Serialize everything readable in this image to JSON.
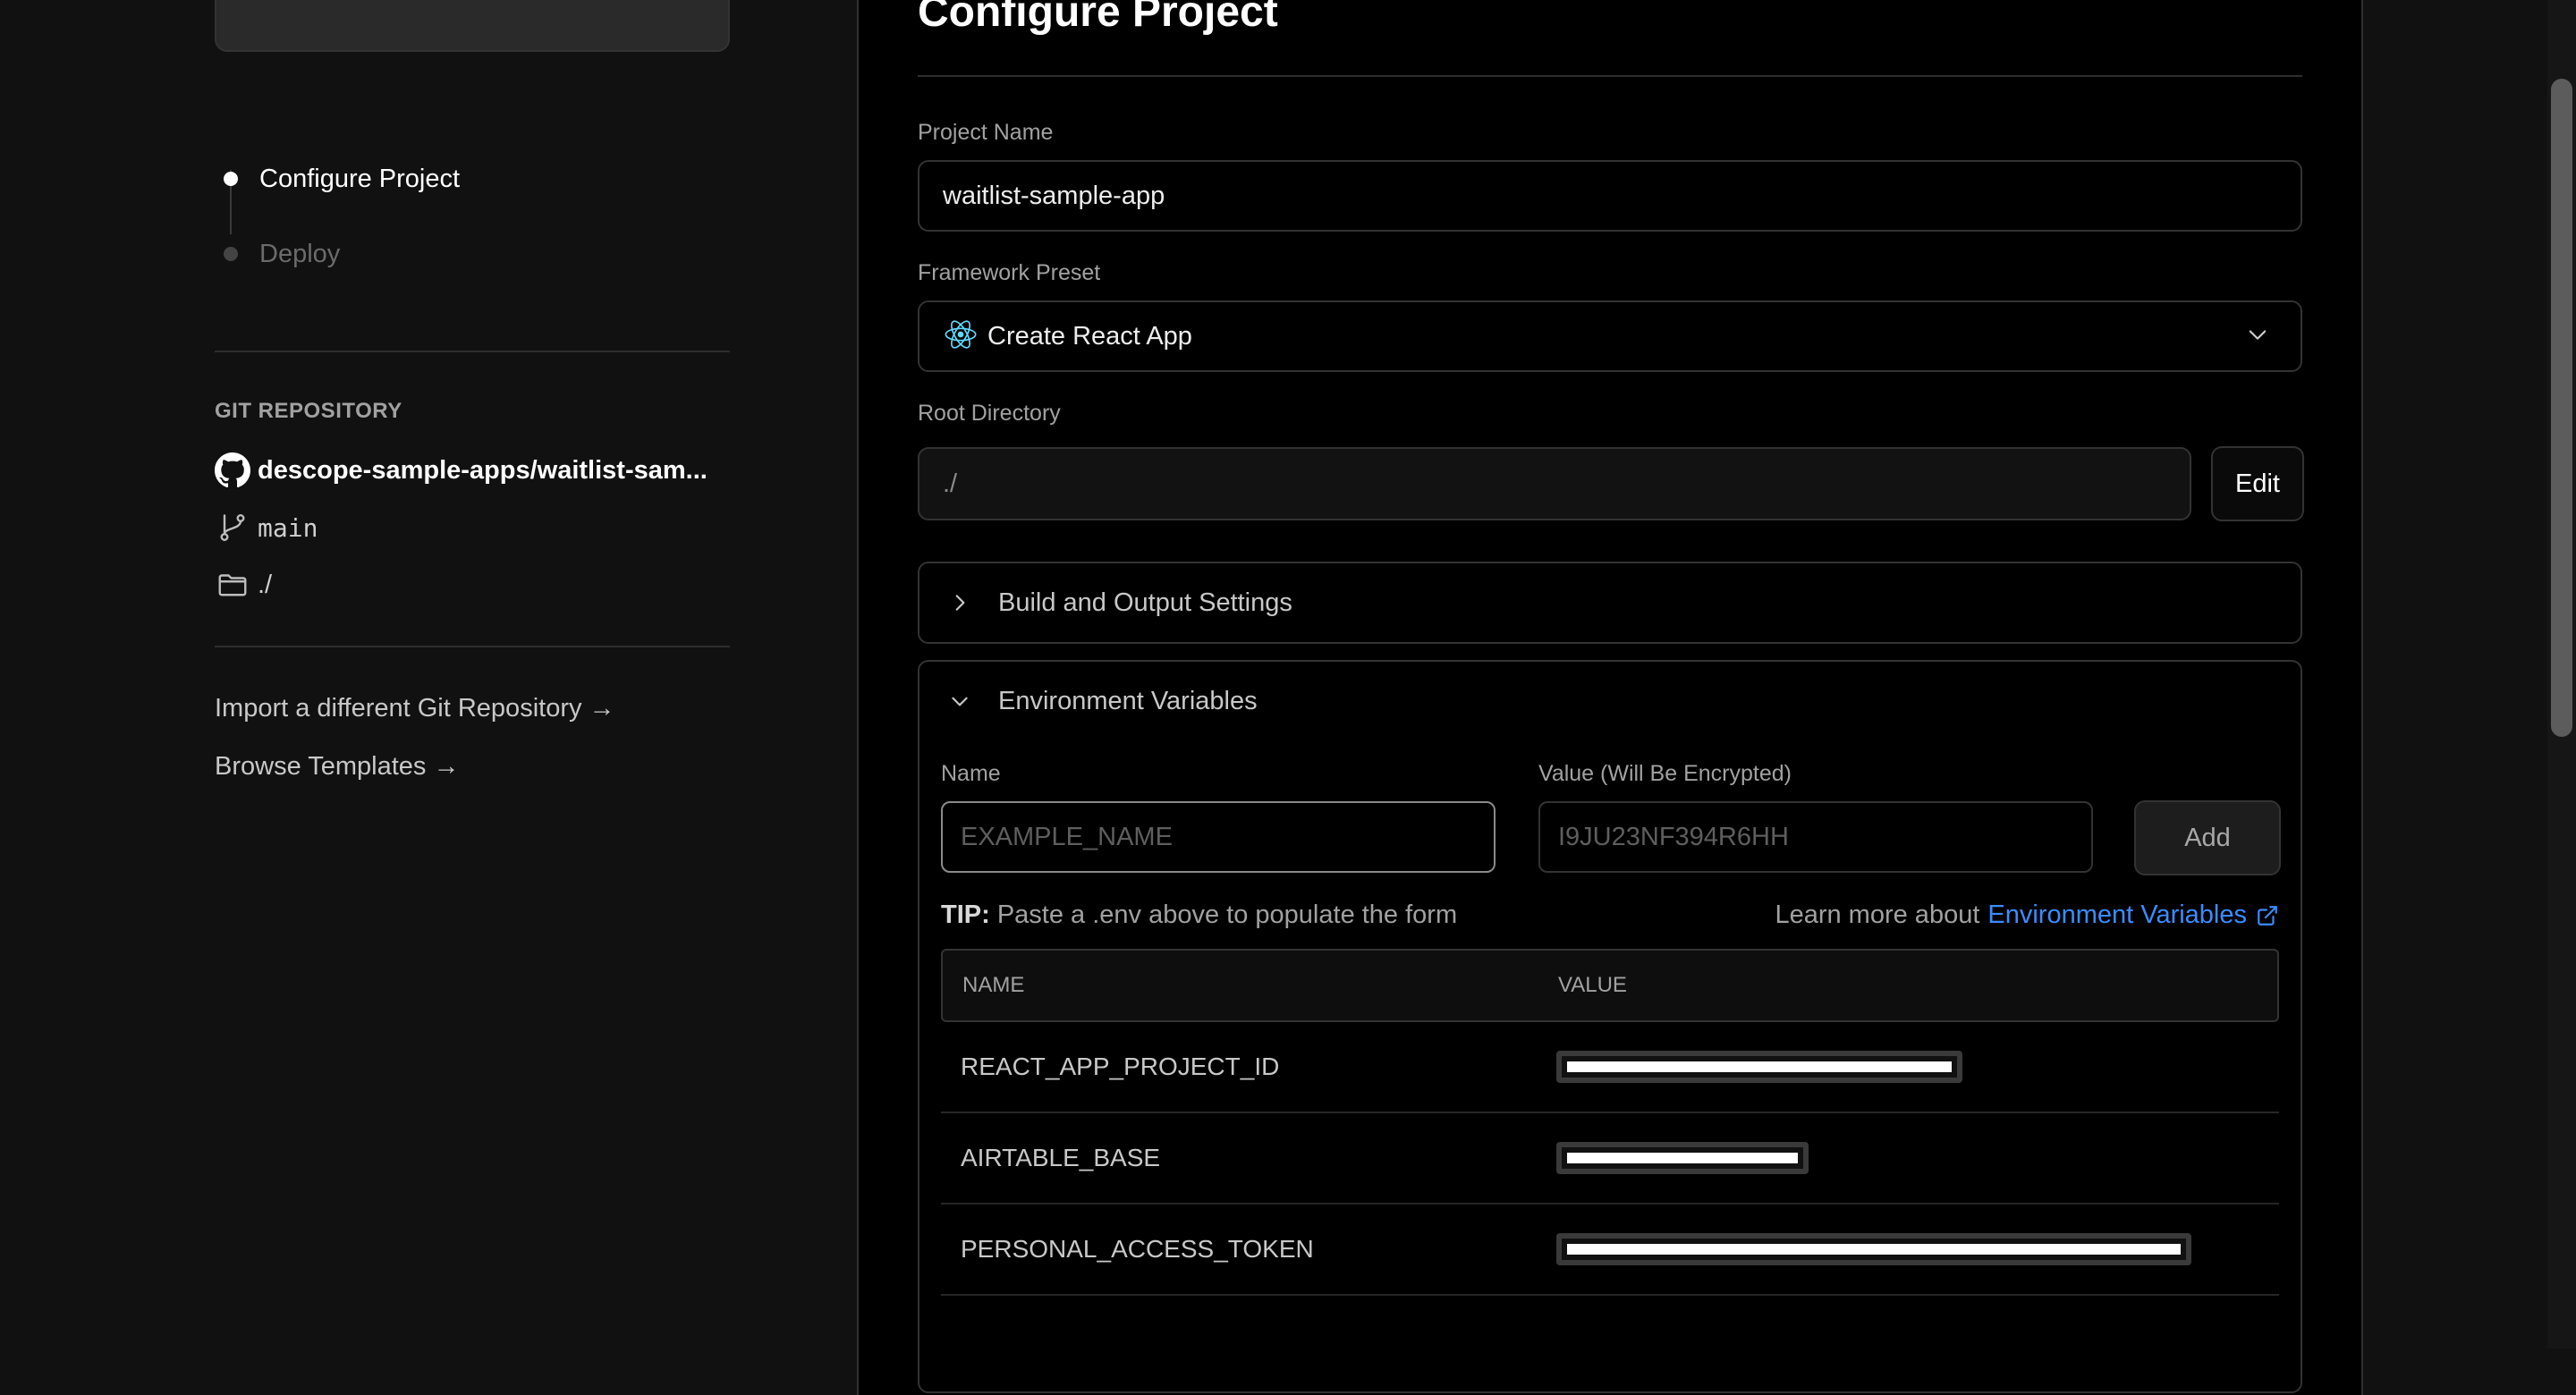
{
  "sidebar": {
    "steps": [
      {
        "label": "Configure Project",
        "active": true
      },
      {
        "label": "Deploy",
        "active": false
      }
    ],
    "git_heading": "GIT REPOSITORY",
    "repo": "descope-sample-apps/waitlist-sam...",
    "branch": "main",
    "directory": "./",
    "import_link": "Import a different Git Repository →",
    "templates_link": "Browse Templates →"
  },
  "main": {
    "title": "Configure Project",
    "project_name": {
      "label": "Project Name",
      "value": "waitlist-sample-app"
    },
    "framework": {
      "label": "Framework Preset",
      "value": "Create React App",
      "icon": "react-icon"
    },
    "root_directory": {
      "label": "Root Directory",
      "value": "./",
      "edit_label": "Edit"
    },
    "build_settings": {
      "label": "Build and Output Settings",
      "expanded": false
    },
    "env_vars": {
      "label": "Environment Variables",
      "expanded": true,
      "name_label": "Name",
      "name_placeholder": "EXAMPLE_NAME",
      "value_label": "Value (Will Be Encrypted)",
      "value_placeholder": "I9JU23NF394R6HH",
      "add_label": "Add",
      "tip_bold": "TIP:",
      "tip_text": " Paste a .env above to populate the form",
      "learn_text": "Learn more about",
      "learn_link": "Environment Variables",
      "table": {
        "headers": [
          "NAME",
          "VALUE"
        ],
        "rows": [
          {
            "name": "REACT_APP_PROJECT_ID",
            "value_redacted": true
          },
          {
            "name": "AIRTABLE_BASE",
            "value_redacted": true
          },
          {
            "name": "PERSONAL_ACCESS_TOKEN",
            "value_redacted": true
          }
        ]
      }
    }
  },
  "colors": {
    "background": "#111111",
    "panel": "#000000",
    "link": "#3b8cff",
    "react": "#61dafb"
  }
}
